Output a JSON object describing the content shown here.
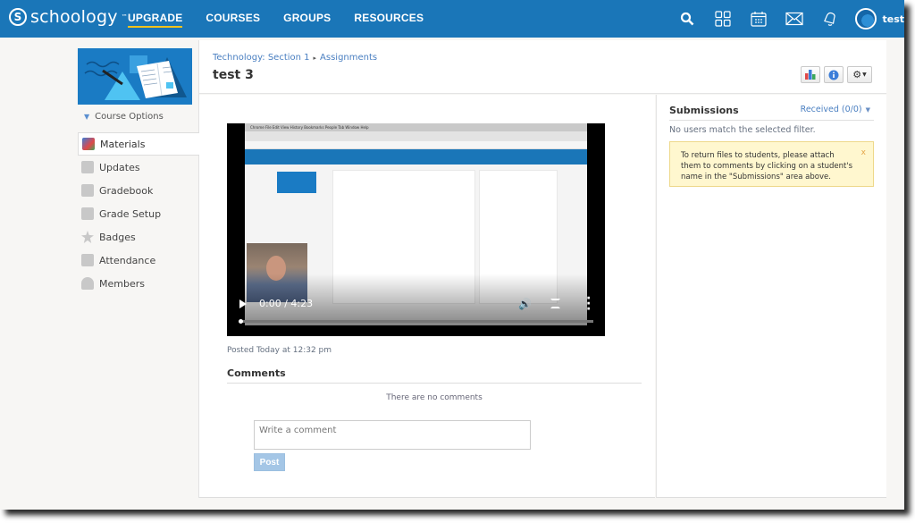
{
  "header": {
    "logo_text": "schoology",
    "logo_mark": "S",
    "nav": [
      {
        "label": "UPGRADE",
        "active": true
      },
      {
        "label": "COURSES",
        "active": false
      },
      {
        "label": "GROUPS",
        "active": false
      },
      {
        "label": "RESOURCES",
        "active": false
      }
    ],
    "icons": [
      "search-icon",
      "apps-grid-icon",
      "calendar-icon",
      "mail-icon",
      "bell-icon"
    ],
    "username": "test",
    "accent_color": "#1a76b8",
    "active_underline_color": "#f2c21b"
  },
  "sidebar": {
    "course_options_label": "Course Options",
    "items": [
      {
        "label": "Materials",
        "icon": "materials-icon",
        "active": true
      },
      {
        "label": "Updates",
        "icon": "updates-icon",
        "active": false
      },
      {
        "label": "Gradebook",
        "icon": "gradebook-icon",
        "active": false
      },
      {
        "label": "Grade Setup",
        "icon": "grade-setup-icon",
        "active": false
      },
      {
        "label": "Badges",
        "icon": "badges-icon",
        "active": false
      },
      {
        "label": "Attendance",
        "icon": "attendance-icon",
        "active": false
      },
      {
        "label": "Members",
        "icon": "members-icon",
        "active": false
      }
    ]
  },
  "breadcrumb": {
    "course": "Technology: Section 1",
    "separator": "▸",
    "section": "Assignments"
  },
  "page_title": "test 3",
  "toolbar": {
    "buttons": [
      "analytics-icon",
      "info-icon",
      "gear-icon"
    ]
  },
  "video": {
    "time": "0:00 / 4:23",
    "progress": 0,
    "inner_menu": " Chrome  File  Edit  View  History  Bookmarks  People  Tab  Window  Help"
  },
  "posted": "Posted Today at 12:32 pm",
  "comments": {
    "heading": "Comments",
    "empty_text": "There are no comments",
    "placeholder": "Write a comment",
    "post_label": "Post"
  },
  "submissions": {
    "title": "Submissions",
    "filter": "Received (0/0)",
    "empty": "No users match the selected filter.",
    "notice": "To return files to students, please attach them to comments by clicking on a student's name in the \"Submissions\" area above.",
    "close": "x"
  }
}
